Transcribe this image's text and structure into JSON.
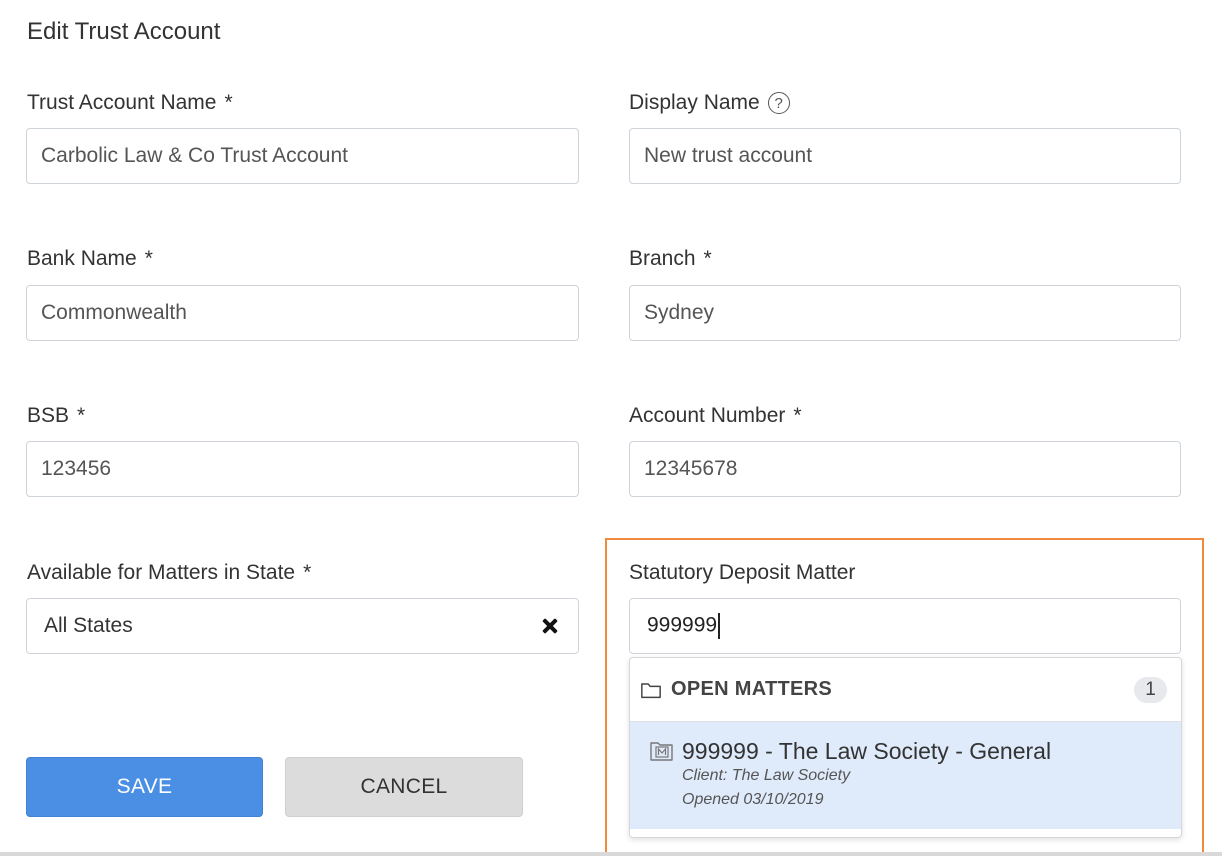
{
  "page": {
    "title": "Edit Trust Account"
  },
  "fields": {
    "trust_account_name": {
      "label": "Trust Account Name",
      "required_mark": "*",
      "value": "Carbolic Law & Co Trust Account"
    },
    "display_name": {
      "label": "Display Name",
      "help": "?",
      "value": "New trust account"
    },
    "bank_name": {
      "label": "Bank Name",
      "required_mark": "*",
      "value": "Commonwealth"
    },
    "branch": {
      "label": "Branch",
      "required_mark": "*",
      "value": "Sydney"
    },
    "bsb": {
      "label": "BSB",
      "required_mark": "*",
      "value": "123456"
    },
    "account_number": {
      "label": "Account Number",
      "required_mark": "*",
      "value": "12345678"
    },
    "state": {
      "label": "Available for Matters in State",
      "required_mark": "*",
      "value": "All States"
    },
    "statutory_deposit_matter": {
      "label": "Statutory Deposit Matter",
      "value": "999999"
    }
  },
  "dropdown": {
    "group_title": "OPEN MATTERS",
    "count": "1",
    "items": [
      {
        "title": "999999 - The Law Society - General",
        "client": "Client: The Law Society",
        "opened": "Opened 03/10/2019"
      }
    ]
  },
  "buttons": {
    "save": "SAVE",
    "cancel": "CANCEL"
  },
  "colors": {
    "primary": "#4a8fe4",
    "highlight": "#ef8a3f",
    "selected_item": "#dfebfb"
  }
}
